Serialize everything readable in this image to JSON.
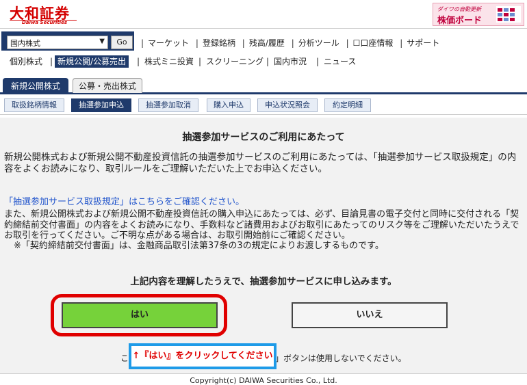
{
  "header": {
    "logo_jp": "大和証券",
    "logo_en": "Daiwa Securities",
    "banner_sub": "ダイワの自動更新",
    "banner_main": "株価ボード"
  },
  "nav1": {
    "select_value": "国内株式",
    "select_arrow": "▼",
    "go_label": "Go",
    "links": [
      "マーケット",
      "登録銘柄",
      "残高/履歴",
      "分析ツール",
      "口座情報",
      "サポート"
    ],
    "account_checkbox": "☐"
  },
  "nav2": {
    "items": [
      "個別株式",
      "新規公開/公募売出",
      "株式ミニ投資",
      "スクリーニング",
      "国内市況",
      "ニュース"
    ]
  },
  "tabs": [
    "新規公開株式",
    "公募・売出株式"
  ],
  "subtabs": [
    "取扱銘柄情報",
    "抽選参加申込",
    "抽選参加取消",
    "購入申込",
    "申込状況照会",
    "約定明細"
  ],
  "content": {
    "title": "抽選参加サービスのご利用にあたって",
    "paragraph1": "新規公開株式および新規公開不動産投資信託の抽選参加サービスのご利用にあたっては、「抽選参加サービス取扱規定」の内容をよくお読みになり、取引ルールをご理解いただいた上でお申込ください。",
    "link": "「抽選参加サービス取扱規定」はこちらをご確認ください。",
    "paragraph2": "また、新規公開株式および新規公開不動産投資信託の購入申込にあたっては、必ず、目論見書の電子交付と同時に交付される「契約締結前交付書面」の内容をよくお読みになり、手数料など諸費用およびお取引にあたってのリスク等をご理解いただいたうえでお取引を行ってください。ご不明な点がある場合は、お取引開始前にご確認ください。",
    "paragraph3": "※「契約締結前交付書面」は、金融商品取引法第37条の3の規定によりお渡しするものです。",
    "confirm": "上記内容を理解したうえで、抽選参加サービスに申し込みます。",
    "yes": "はい",
    "no": "いいえ",
    "note_left": "こ",
    "note_right": "」ボタンは使用しないでください。",
    "callout": "↑『はい』をクリックしてください"
  },
  "footer": "Copyright(c) DAIWA Securities Co., Ltd.",
  "colors": {
    "brand_red": "#d40000",
    "nav_navy": "#1f3a6b",
    "yes_green": "#76d23a",
    "highlight_red": "#e00000",
    "callout_blue": "#1e9be8"
  }
}
